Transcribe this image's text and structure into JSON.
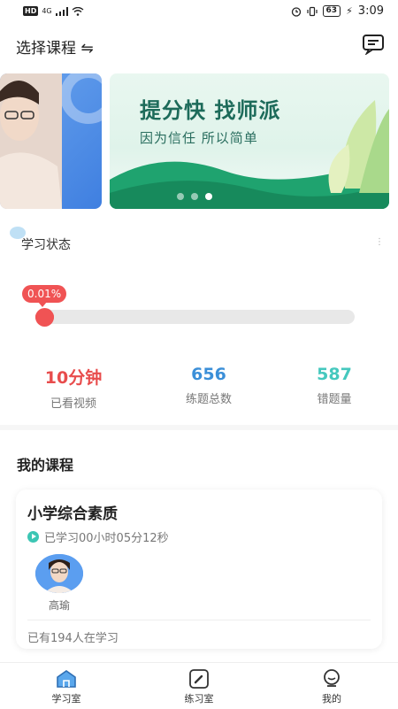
{
  "status_bar": {
    "network": "4G",
    "time": "3:09",
    "battery": "63",
    "hd": "HD"
  },
  "header": {
    "title": "选择课程 ⇋",
    "message_icon": "message-icon"
  },
  "banner": {
    "title": "提分快 找师派",
    "subtitle": "因为信任 所以简单",
    "slides": 3,
    "active_slide": 3
  },
  "study_status": {
    "title": "学习状态",
    "more_indicator": "⋮",
    "progress_label": "0.01%",
    "progress_value": 0.0001,
    "stats": [
      {
        "value": "10分钟",
        "label": "已看视频",
        "color": "#e84c4c"
      },
      {
        "value": "656",
        "label": "练题总数",
        "color": "#3b8fd8"
      },
      {
        "value": "587",
        "label": "错题量",
        "color": "#45c8be"
      }
    ]
  },
  "my_courses": {
    "title": "我的课程",
    "course": {
      "name": "小学综合素质",
      "progress_text": "已学习00小时05分12秒",
      "teacher": "高瑜",
      "learners": "已有194人在学习"
    }
  },
  "tabbar": {
    "tabs": [
      {
        "label": "学习室",
        "icon": "home-icon",
        "active": true
      },
      {
        "label": "练习室",
        "icon": "pen-icon",
        "active": false
      },
      {
        "label": "我的",
        "icon": "profile-icon",
        "active": false
      }
    ]
  },
  "colors": {
    "accent_red": "#f05354",
    "teal": "#3cc6b4",
    "blue": "#3b8fd8"
  }
}
